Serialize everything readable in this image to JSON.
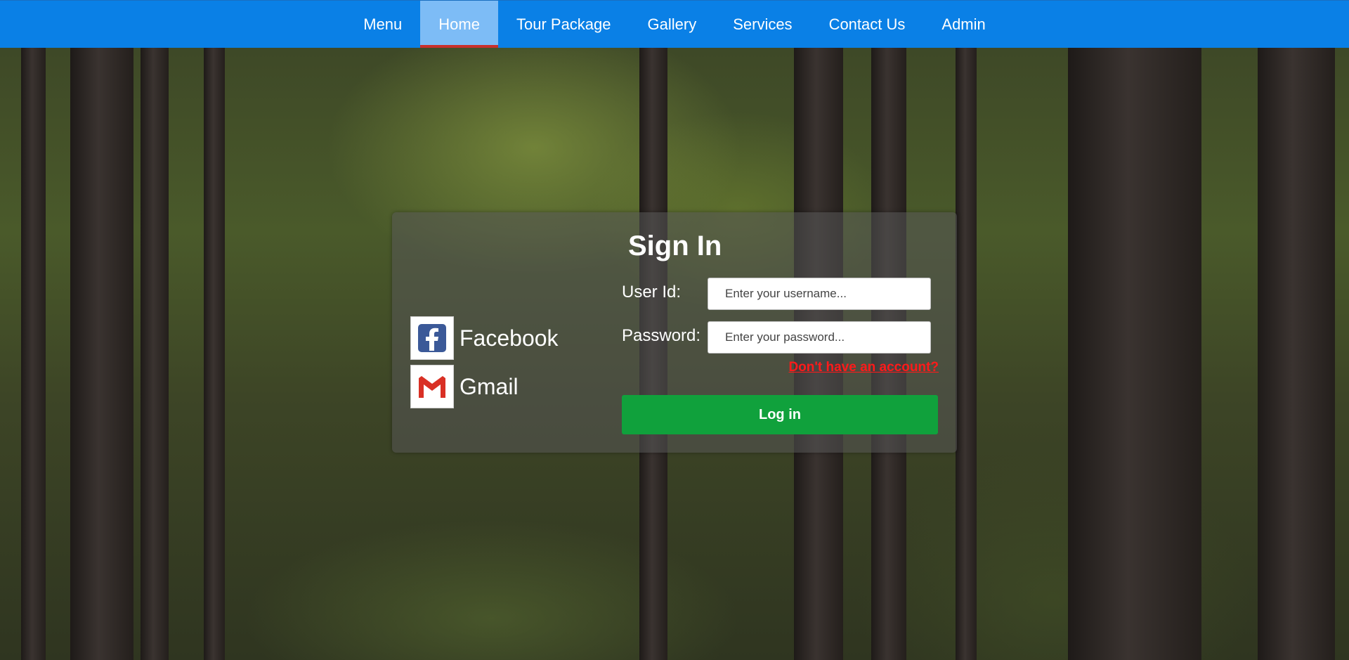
{
  "nav": {
    "items": [
      {
        "label": "Menu"
      },
      {
        "label": "Home",
        "active": true
      },
      {
        "label": "Tour Package"
      },
      {
        "label": "Gallery"
      },
      {
        "label": "Services"
      },
      {
        "label": "Contact Us"
      },
      {
        "label": "Admin"
      }
    ],
    "color": "#0a80e6",
    "active_color": "#7dbcf6"
  },
  "social": {
    "facebook": {
      "label": "Facebook",
      "icon": "facebook-icon"
    },
    "gmail": {
      "label": "Gmail",
      "icon": "gmail-icon"
    }
  },
  "signin": {
    "title": "Sign In",
    "user_label": "User Id:",
    "user_placeholder": "Enter your username...",
    "pass_label": "Password:",
    "pass_placeholder": "Enter your password...",
    "signup_link": "Don't have an account?",
    "login_button": "Log in",
    "button_color": "#10a13c",
    "link_color": "#ff1a1a"
  }
}
